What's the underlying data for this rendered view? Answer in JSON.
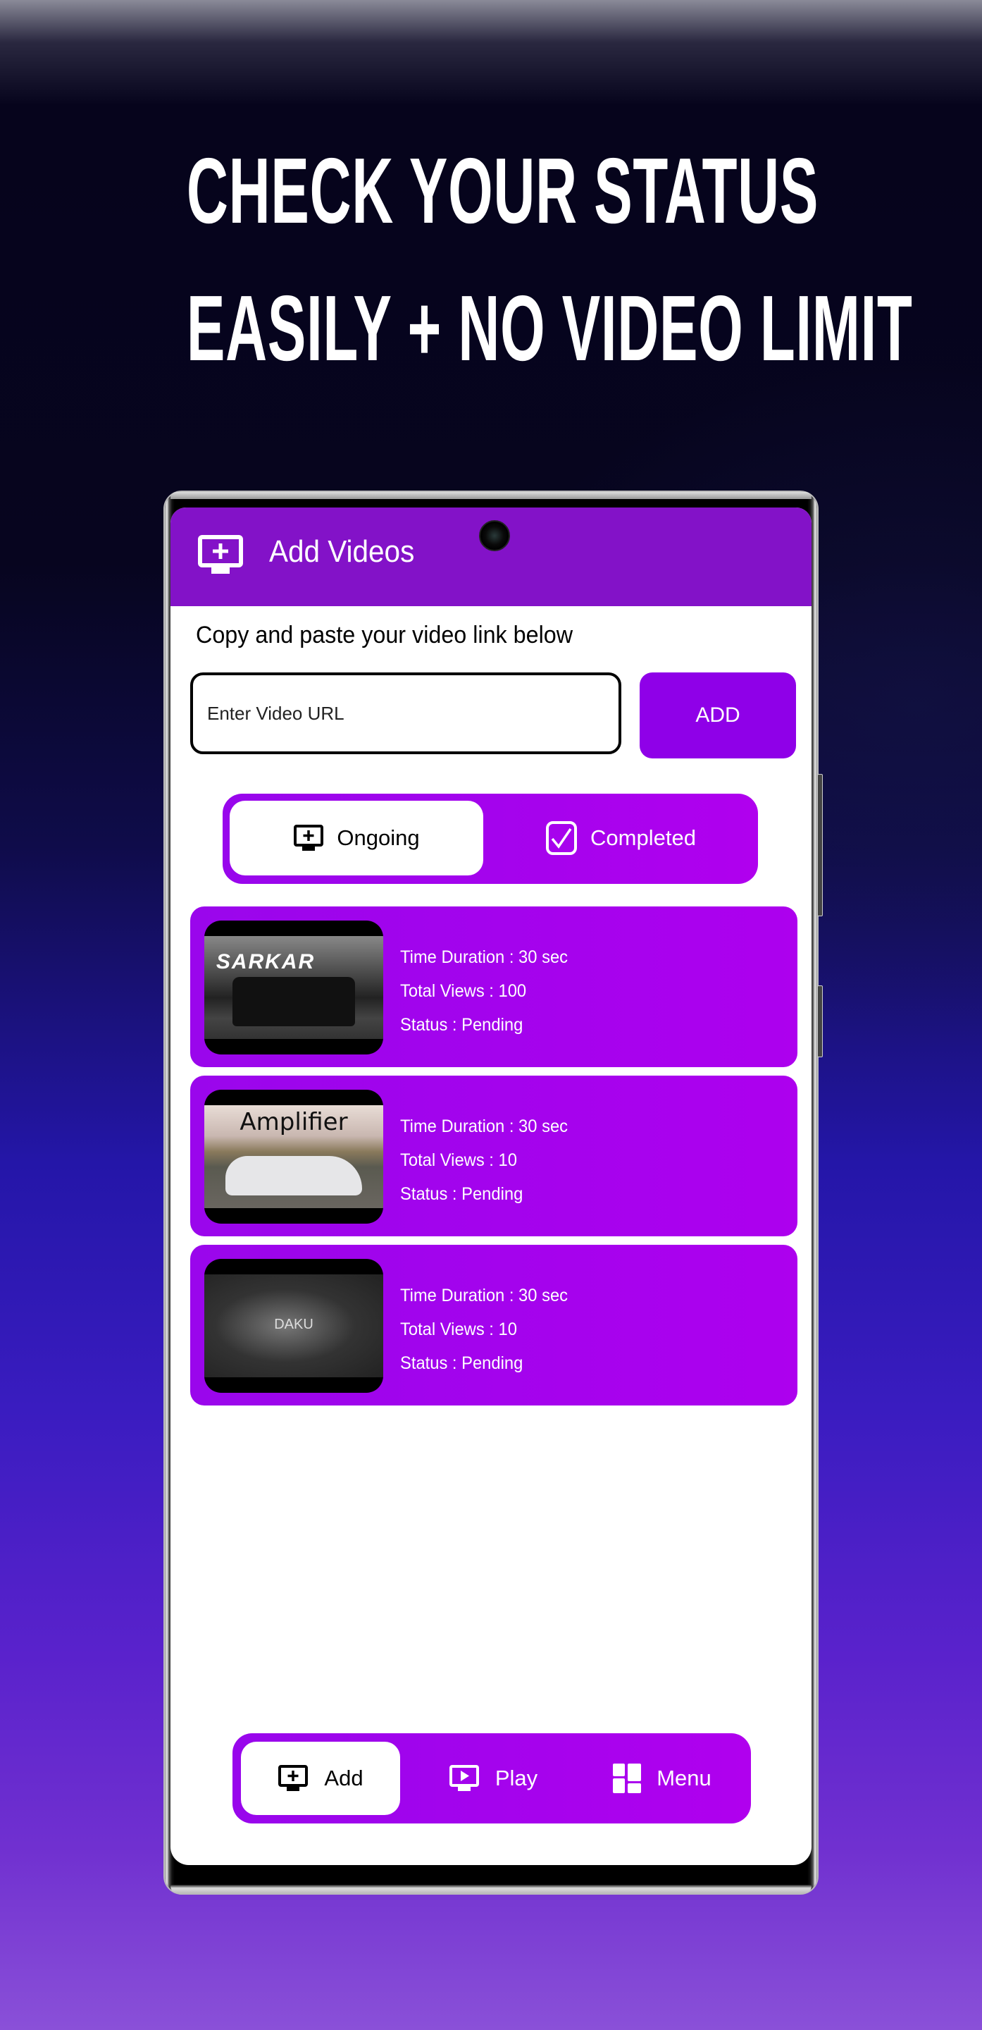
{
  "headline": {
    "line1": "CHECK YOUR STATUS",
    "line2": "EASILY + NO VIDEO LIMIT"
  },
  "app": {
    "title": "Add Videos",
    "title_icon": "add-to-screen-icon",
    "prompt": "Copy and paste your video link below",
    "url_input": {
      "placeholder": "Enter Video URL",
      "value": ""
    },
    "add_button": "ADD",
    "accent_color": "#9006e8"
  },
  "tabs": [
    {
      "label": "Ongoing",
      "icon": "add-to-screen-icon",
      "active": true
    },
    {
      "label": "Completed",
      "icon": "checkbox-checked-icon",
      "active": false
    }
  ],
  "videos": [
    {
      "thumbnail_title": "SARKAR",
      "duration": "Time Duration : 30 sec",
      "views": "Total Views : 100",
      "status": "Status : Pending"
    },
    {
      "thumbnail_title": "Amplifier",
      "duration": "Time Duration : 30 sec",
      "views": "Total Views : 10",
      "status": "Status : Pending"
    },
    {
      "thumbnail_title": "DAKU",
      "duration": "Time Duration : 30 sec",
      "views": "Total Views : 10",
      "status": "Status : Pending"
    }
  ],
  "bottom_nav": [
    {
      "label": "Add",
      "icon": "add-to-screen-icon",
      "active": true
    },
    {
      "label": "Play",
      "icon": "play-screen-icon",
      "active": false
    },
    {
      "label": "Menu",
      "icon": "dashboard-grid-icon",
      "active": false
    }
  ]
}
